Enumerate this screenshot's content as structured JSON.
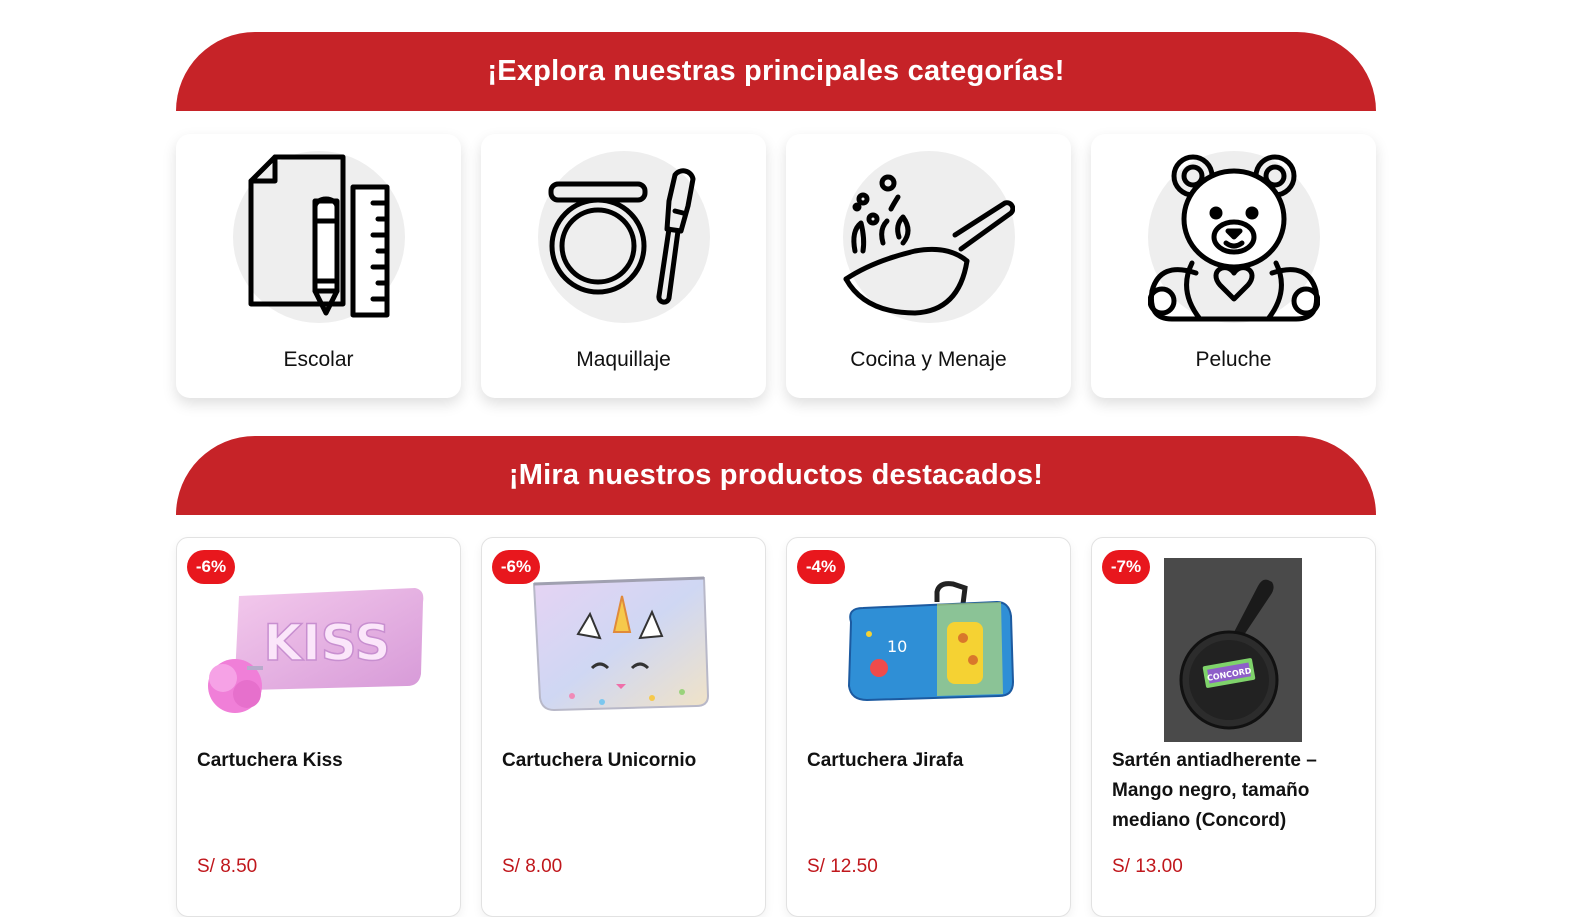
{
  "categories_section": {
    "title": "¡Explora nuestras principales categorías!",
    "items": [
      {
        "label": "Escolar",
        "icon": "school-supplies-icon"
      },
      {
        "label": "Maquillaje",
        "icon": "makeup-icon"
      },
      {
        "label": "Cocina y Menaje",
        "icon": "cooking-pan-icon"
      },
      {
        "label": "Peluche",
        "icon": "teddy-bear-icon"
      }
    ]
  },
  "products_section": {
    "title": "¡Mira nuestros productos destacados!",
    "items": [
      {
        "discount": "-6%",
        "name": "Cartuchera Kiss",
        "price": "S/ 8.50"
      },
      {
        "discount": "-6%",
        "name": "Cartuchera Unicornio",
        "price": "S/ 8.00"
      },
      {
        "discount": "-4%",
        "name": "Cartuchera Jirafa",
        "price": "S/ 12.50"
      },
      {
        "discount": "-7%",
        "name": "Sartén antiadherente – Mango negro, tamaño mediano (Concord)",
        "price": "S/ 13.00"
      }
    ]
  },
  "colors": {
    "banner": "#c62328",
    "badge": "#e8171d",
    "price": "#c0171c"
  }
}
